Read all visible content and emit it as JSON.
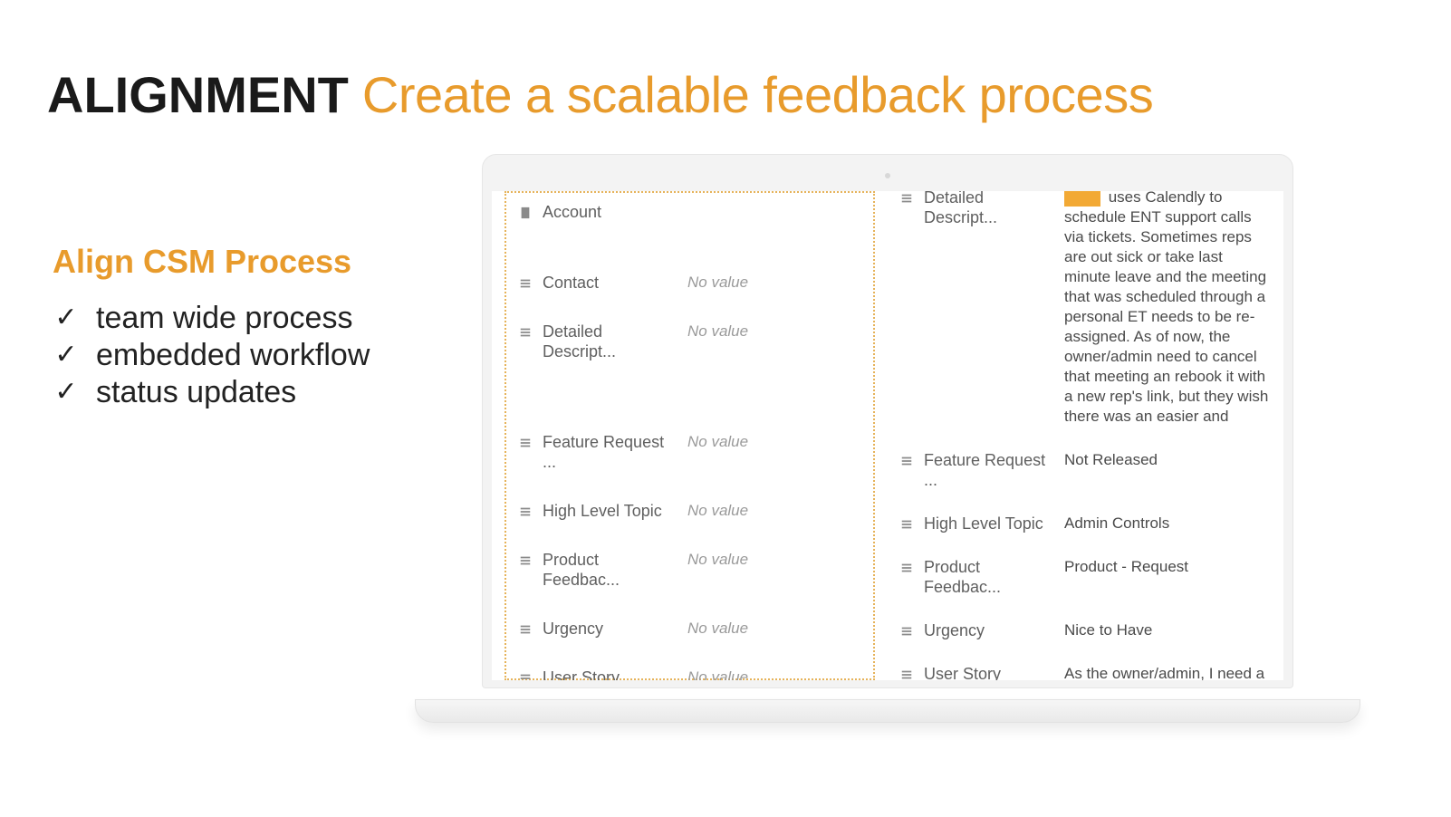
{
  "title_bold": "ALIGNMENT",
  "title_rest": " Create a scalable feedback process",
  "subhead": "Align CSM Process",
  "bullets": [
    "team wide process",
    "embedded workflow",
    "status updates"
  ],
  "left_panel": [
    {
      "icon": "building",
      "label": "Account",
      "value": "",
      "empty": false,
      "first": true
    },
    {
      "icon": "list",
      "label": "Contact",
      "value": "No value",
      "empty": true
    },
    {
      "icon": "list",
      "label": "Detailed Descript...",
      "value": "No value",
      "empty": true,
      "gap": true
    },
    {
      "icon": "list",
      "label": "Feature Request ...",
      "value": "No value",
      "empty": true
    },
    {
      "icon": "list",
      "label": "High Level Topic",
      "value": "No value",
      "empty": true
    },
    {
      "icon": "list",
      "label": "Product Feedbac...",
      "value": "No value",
      "empty": true
    },
    {
      "icon": "list",
      "label": "Urgency",
      "value": "No value",
      "empty": true
    },
    {
      "icon": "list",
      "label": "User Story",
      "value": "No value",
      "empty": true
    }
  ],
  "right_panel": [
    {
      "icon": "list",
      "label": "Detailed Descript...",
      "value": " uses Calendly to schedule ENT support calls via tickets.  Sometimes reps are out sick or take last minute leave and the meeting that was scheduled through a personal ET needs to be re-assigned.  As of now, the owner/admin need to cancel that meeting an rebook it with a new rep's link, but they wish there was an easier and",
      "redact": true
    },
    {
      "icon": "list",
      "label": "Feature Request ...",
      "value": "Not Released"
    },
    {
      "icon": "list",
      "label": "High Level Topic",
      "value": "Admin Controls"
    },
    {
      "icon": "list",
      "label": "Product Feedbac...",
      "value": "Product - Request"
    },
    {
      "icon": "list",
      "label": "Urgency",
      "value": "Nice to Have"
    },
    {
      "icon": "list",
      "label": "User Story",
      "value": "As the owner/admin, I need a way to seamlessly re-assign an existing personal Calendly scheduled meeting to another Support rep within Calendly."
    }
  ]
}
